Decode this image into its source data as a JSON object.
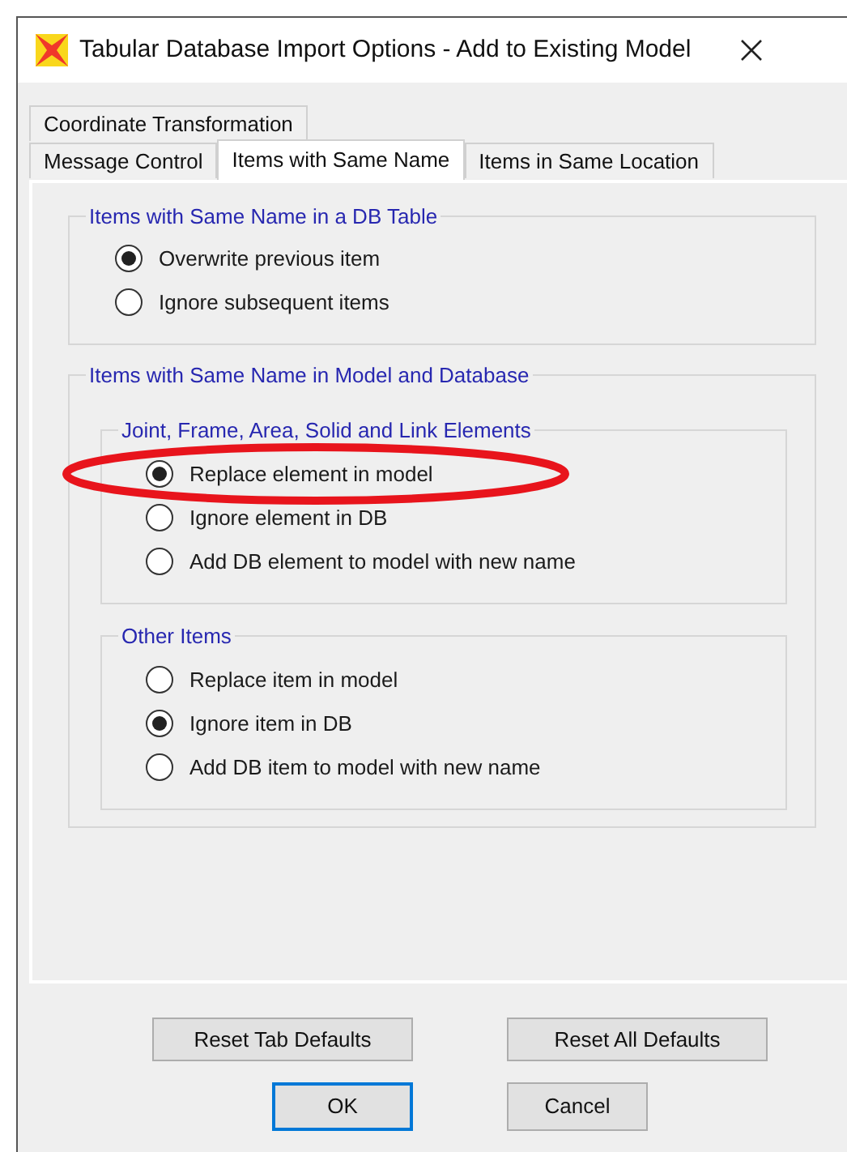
{
  "window": {
    "title": "Tabular Database Import Options - Add to Existing Model"
  },
  "tab_rows": [
    [
      {
        "label": "Coordinate Transformation",
        "selected": false
      }
    ],
    [
      {
        "label": "Message Control",
        "selected": false
      },
      {
        "label": "Items with Same Name",
        "selected": true
      },
      {
        "label": "Items in Same Location",
        "selected": false
      }
    ]
  ],
  "groups": [
    {
      "title": "Items with Same Name in a DB Table",
      "options": [
        {
          "label": "Overwrite previous item",
          "selected": true
        },
        {
          "label": "Ignore subsequent items",
          "selected": false
        }
      ]
    },
    {
      "title": "Items with Same Name in Model and Database",
      "subgroups": [
        {
          "title": "Joint, Frame, Area, Solid and Link Elements",
          "options": [
            {
              "label": "Replace element in model",
              "selected": true,
              "highlighted": true
            },
            {
              "label": "Ignore element in DB",
              "selected": false
            },
            {
              "label": "Add DB element to model with new name",
              "selected": false
            }
          ]
        },
        {
          "title": "Other Items",
          "options": [
            {
              "label": "Replace item in model",
              "selected": false
            },
            {
              "label": "Ignore item in DB",
              "selected": true
            },
            {
              "label": "Add DB item to model with new name",
              "selected": false
            }
          ]
        }
      ]
    }
  ],
  "buttons": [
    [
      "Reset Tab Defaults",
      "Reset All Defaults"
    ],
    [
      "OK",
      "Cancel"
    ]
  ]
}
